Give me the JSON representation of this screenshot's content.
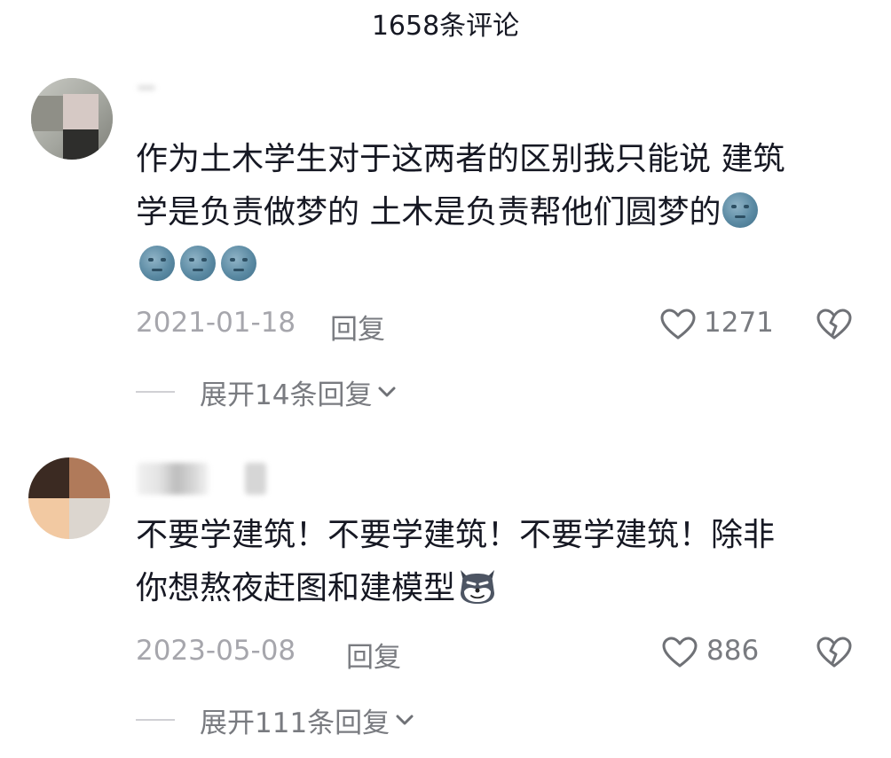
{
  "header": {
    "title": "1658条评论"
  },
  "comments": [
    {
      "text_line1": "作为土木学生对于这两者的区别我只能说 建筑",
      "text_line2": "学是负责做梦的 土木是负责帮他们圆梦的",
      "emoji": "moon-face",
      "date": "2021-01-18",
      "reply_label": "回复",
      "likes": "1271",
      "expand_label": "展开14条回复"
    },
    {
      "text_line1": "不要学建筑！不要学建筑！不要学建筑！除非",
      "text_line2": "你想熬夜赶图和建模型",
      "emoji": "husky",
      "date": "2023-05-08",
      "reply_label": "回复",
      "likes": "886",
      "expand_label": "展开111条回复"
    }
  ],
  "colors": {
    "text": "#161823",
    "meta": "#a6a6ac",
    "secondary": "#797b80"
  }
}
